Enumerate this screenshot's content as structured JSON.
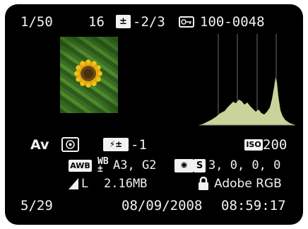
{
  "top": {
    "frame_counter": "1/50",
    "exposure_value": "16",
    "exposure_comp": "-2/3",
    "file_number": "100-0048"
  },
  "histogram": {
    "type": "luminance histogram",
    "color": "#c9d39a",
    "grid_lines": 4
  },
  "settings": {
    "mode": "Av",
    "flash_comp": "-1",
    "iso_label": "ISO",
    "iso_value": "200",
    "wb_badge": "AWB",
    "wb_shift": "A3, G2",
    "picture_style_badge": "S",
    "picture_style_values": "3, 0, 0, 0",
    "quality": "L",
    "file_size": "2.16MB",
    "color_space": "Adobe RGB"
  },
  "bottom": {
    "folder_counter": "5/29",
    "date": "08/09/2008",
    "time": "08:59:17"
  }
}
